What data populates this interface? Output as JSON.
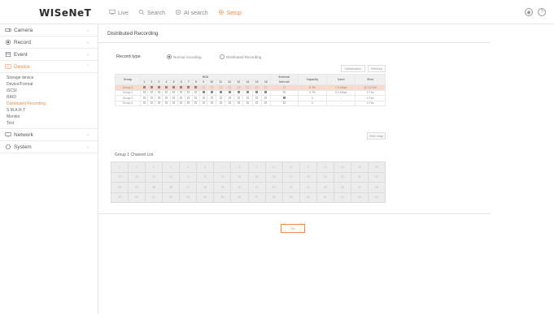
{
  "app": {
    "logo": "WISeNeT"
  },
  "topnav": [
    {
      "label": "Live",
      "icon": "monitor-icon",
      "active": false
    },
    {
      "label": "Search",
      "icon": "search-icon",
      "active": false
    },
    {
      "label": "AI search",
      "icon": "ai-search-icon",
      "active": false
    },
    {
      "label": "Setup",
      "icon": "gear-icon",
      "active": true
    }
  ],
  "topright": {
    "user": "",
    "help_icon": "help-icon",
    "user_icon": "user-icon",
    "menu_label": ""
  },
  "sidebar": {
    "menus": [
      {
        "label": "Camera",
        "icon": "camera-icon"
      },
      {
        "label": "Record",
        "icon": "record-icon"
      },
      {
        "label": "Event",
        "icon": "event-icon"
      },
      {
        "label": "Device",
        "icon": "device-icon",
        "active": true
      }
    ],
    "device_items": [
      {
        "label": "Storage device",
        "active": false
      },
      {
        "label": "Device/Format",
        "active": false
      },
      {
        "label": "iSCSI",
        "active": false
      },
      {
        "label": "RAID",
        "active": false
      },
      {
        "label": "Distributed Recording",
        "active": true
      },
      {
        "label": "S.M.A.R.T",
        "active": false
      },
      {
        "label": "Monitor",
        "active": false
      },
      {
        "label": "Text",
        "active": false
      }
    ],
    "bottom_menus": [
      {
        "label": "Network",
        "icon": "network-icon"
      },
      {
        "label": "System",
        "icon": "system-icon"
      }
    ]
  },
  "page": {
    "title": "Distributed Recording",
    "record_type_label": "Record type",
    "radio_normal": "Normal recording",
    "radio_distributed": "Distributed Recording",
    "btn_initialization": "Initialization",
    "btn_refresh": "Refresh",
    "btn_set_hdd": "HDD Map",
    "group_list_title": "Group 1 Channel List",
    "ok_label": "OK"
  },
  "table": {
    "header_hdd": "HDD",
    "header_external": "External",
    "col_group": "Group",
    "col_capacity": "Capacity",
    "col_used": "Used",
    "col_rest": "Rest",
    "col_ext_sub": "Internal",
    "hdd_numbers": [
      "1",
      "2",
      "3",
      "4",
      "5",
      "6",
      "7",
      "8",
      "9",
      "10",
      "11",
      "12",
      "13",
      "14",
      "15",
      "16"
    ],
    "rows": [
      {
        "group": "Group 1",
        "hdd": [
          1,
          1,
          1,
          1,
          1,
          1,
          1,
          1,
          0,
          0,
          0,
          0,
          0,
          0,
          0,
          0
        ],
        "ext": 0,
        "capacity": "8 TB",
        "used": "7.9 Mbps",
        "rest": "(1+1) Tbs",
        "highlight": true
      },
      {
        "group": "Group 2",
        "hdd": [
          0,
          0,
          0,
          0,
          0,
          0,
          0,
          0,
          1,
          1,
          1,
          1,
          1,
          1,
          1,
          1
        ],
        "ext": 0,
        "capacity": "8 TB",
        "used": "5.3 Mbps",
        "rest": "0 Tbs",
        "highlight": false
      },
      {
        "group": "Group 3",
        "hdd": [
          0,
          0,
          0,
          0,
          0,
          0,
          0,
          0,
          0,
          0,
          0,
          0,
          0,
          0,
          0,
          0
        ],
        "ext": 1,
        "capacity": "0",
        "used": "-",
        "rest": "0 Tbs",
        "highlight": false
      },
      {
        "group": "Group 4",
        "hdd": [
          0,
          0,
          0,
          0,
          0,
          0,
          0,
          0,
          0,
          0,
          0,
          0,
          0,
          0,
          0,
          0
        ],
        "ext": 0,
        "capacity": "0",
        "used": "-",
        "rest": "0 Tbs",
        "highlight": false
      }
    ]
  },
  "channel_grid": {
    "rows": [
      [
        "1",
        "2",
        "3",
        "4",
        "5",
        "6",
        "7",
        "8",
        "9",
        "10",
        "11",
        "12",
        "13",
        "14",
        "15",
        "16"
      ],
      [
        "17",
        "18",
        "19",
        "20",
        "21",
        "22",
        "23",
        "24",
        "25",
        "26",
        "27",
        "28",
        "29",
        "30",
        "31",
        "32"
      ],
      [
        "33",
        "34",
        "35",
        "36",
        "37",
        "38",
        "39",
        "40",
        "41",
        "42",
        "43",
        "44",
        "45",
        "46",
        "47",
        "48"
      ],
      [
        "49",
        "50",
        "51",
        "52",
        "53",
        "54",
        "55",
        "56",
        "57",
        "58",
        "59",
        "60",
        "61",
        "62",
        "63",
        "64"
      ]
    ]
  },
  "colors": {
    "accent": "#f08a4b",
    "highlight_row": "#f7d9cd"
  }
}
